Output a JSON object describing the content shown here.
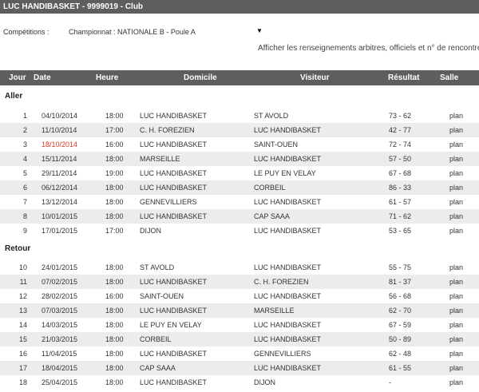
{
  "title": "LUC HANDIBASKET - 9999019 - Club",
  "competitions_label": "Compétitions :",
  "competition_selected": "Championnat : NATIONALE B - Poule A",
  "competition_arrow": "▼",
  "info_link": "Afficher les renseignements arbitres, officiels et n° de rencontre",
  "headers": [
    "Jour",
    "Date",
    "Heure",
    "Domicile",
    "Visiteur",
    "Résultat",
    "Salle"
  ],
  "sections": [
    {
      "label": "Aller",
      "rows": [
        {
          "jour": "1",
          "date": "04/10/2014",
          "heure": "18:00",
          "domicile": "LUC HANDIBASKET",
          "visiteur": "ST AVOLD",
          "resultat": "73 - 62",
          "salle": "plan",
          "highlight": false
        },
        {
          "jour": "2",
          "date": "11/10/2014",
          "heure": "17:00",
          "domicile": "C. H. FOREZIEN",
          "visiteur": "LUC HANDIBASKET",
          "resultat": "42 - 77",
          "salle": "plan",
          "highlight": false
        },
        {
          "jour": "3",
          "date": "18/10/2014",
          "heure": "16:00",
          "domicile": "LUC HANDIBASKET",
          "visiteur": "SAINT-OUEN",
          "resultat": "72 - 74",
          "salle": "plan",
          "highlight": true
        },
        {
          "jour": "4",
          "date": "15/11/2014",
          "heure": "18:00",
          "domicile": "MARSEILLE",
          "visiteur": "LUC HANDIBASKET",
          "resultat": "57 - 50",
          "salle": "plan",
          "highlight": false
        },
        {
          "jour": "5",
          "date": "29/11/2014",
          "heure": "19:00",
          "domicile": "LUC HANDIBASKET",
          "visiteur": "LE PUY EN VELAY",
          "resultat": "67 - 68",
          "salle": "plan",
          "highlight": false
        },
        {
          "jour": "6",
          "date": "06/12/2014",
          "heure": "18:00",
          "domicile": "LUC HANDIBASKET",
          "visiteur": "CORBEIL",
          "resultat": "86 - 33",
          "salle": "plan",
          "highlight": false
        },
        {
          "jour": "7",
          "date": "13/12/2014",
          "heure": "18:00",
          "domicile": "GENNEVILLIERS",
          "visiteur": "LUC HANDIBASKET",
          "resultat": "61 - 57",
          "salle": "plan",
          "highlight": false
        },
        {
          "jour": "8",
          "date": "10/01/2015",
          "heure": "18:00",
          "domicile": "LUC HANDIBASKET",
          "visiteur": "CAP SAAA",
          "resultat": "71 - 62",
          "salle": "plan",
          "highlight": false
        },
        {
          "jour": "9",
          "date": "17/01/2015",
          "heure": "17:00",
          "domicile": "DIJON",
          "visiteur": "LUC HANDIBASKET",
          "resultat": "53 - 65",
          "salle": "plan",
          "highlight": false
        }
      ]
    },
    {
      "label": "Retour",
      "rows": [
        {
          "jour": "10",
          "date": "24/01/2015",
          "heure": "18:00",
          "domicile": "ST AVOLD",
          "visiteur": "LUC HANDIBASKET",
          "resultat": "55 - 75",
          "salle": "plan",
          "highlight": false
        },
        {
          "jour": "11",
          "date": "07/02/2015",
          "heure": "18:00",
          "domicile": "LUC HANDIBASKET",
          "visiteur": "C. H. FOREZIEN",
          "resultat": "81 - 37",
          "salle": "plan",
          "highlight": false
        },
        {
          "jour": "12",
          "date": "28/02/2015",
          "heure": "16:00",
          "domicile": "SAINT-OUEN",
          "visiteur": "LUC HANDIBASKET",
          "resultat": "56 - 68",
          "salle": "plan",
          "highlight": false
        },
        {
          "jour": "13",
          "date": "07/03/2015",
          "heure": "18:00",
          "domicile": "LUC HANDIBASKET",
          "visiteur": "MARSEILLE",
          "resultat": "62 - 70",
          "salle": "plan",
          "highlight": false
        },
        {
          "jour": "14",
          "date": "14/03/2015",
          "heure": "18:00",
          "domicile": "LE PUY EN VELAY",
          "visiteur": "LUC HANDIBASKET",
          "resultat": "67 - 59",
          "salle": "plan",
          "highlight": false
        },
        {
          "jour": "15",
          "date": "21/03/2015",
          "heure": "18:00",
          "domicile": "CORBEIL",
          "visiteur": "LUC HANDIBASKET",
          "resultat": "50 - 89",
          "salle": "plan",
          "highlight": false
        },
        {
          "jour": "16",
          "date": "11/04/2015",
          "heure": "18:00",
          "domicile": "LUC HANDIBASKET",
          "visiteur": "GENNEVILLIERS",
          "resultat": "62 - 48",
          "salle": "plan",
          "highlight": false
        },
        {
          "jour": "17",
          "date": "18/04/2015",
          "heure": "18:00",
          "domicile": "CAP SAAA",
          "visiteur": "LUC HANDIBASKET",
          "resultat": "61 - 55",
          "salle": "plan",
          "highlight": false
        },
        {
          "jour": "18",
          "date": "25/04/2015",
          "heure": "18:00",
          "domicile": "LUC HANDIBASKET",
          "visiteur": "DIJON",
          "resultat": "-",
          "salle": "plan",
          "highlight": false
        }
      ]
    }
  ],
  "colors": {
    "header_bg": "#5e5e5e",
    "row_alt_bg": "#ececec",
    "highlight_date": "#d9381e"
  }
}
